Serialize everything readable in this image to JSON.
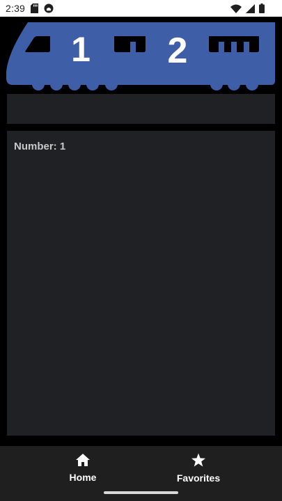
{
  "status_bar": {
    "time": "2:39",
    "left_icons": [
      "sd-card-icon",
      "app-notification-icon"
    ],
    "right_icons": [
      "wifi-icon",
      "cell-signal-icon",
      "battery-icon"
    ]
  },
  "banner": {
    "train_numbers": [
      "1",
      "2"
    ],
    "train_color": "#3f5ea8"
  },
  "content": {
    "number_text": "Number: 1"
  },
  "bottom_nav": {
    "items": [
      {
        "label": "Home",
        "icon": "home-icon"
      },
      {
        "label": "Favorites",
        "icon": "star-icon"
      }
    ]
  },
  "colors": {
    "background": "#000000",
    "panel": "#202124",
    "nav_background": "#1f1f1f"
  }
}
